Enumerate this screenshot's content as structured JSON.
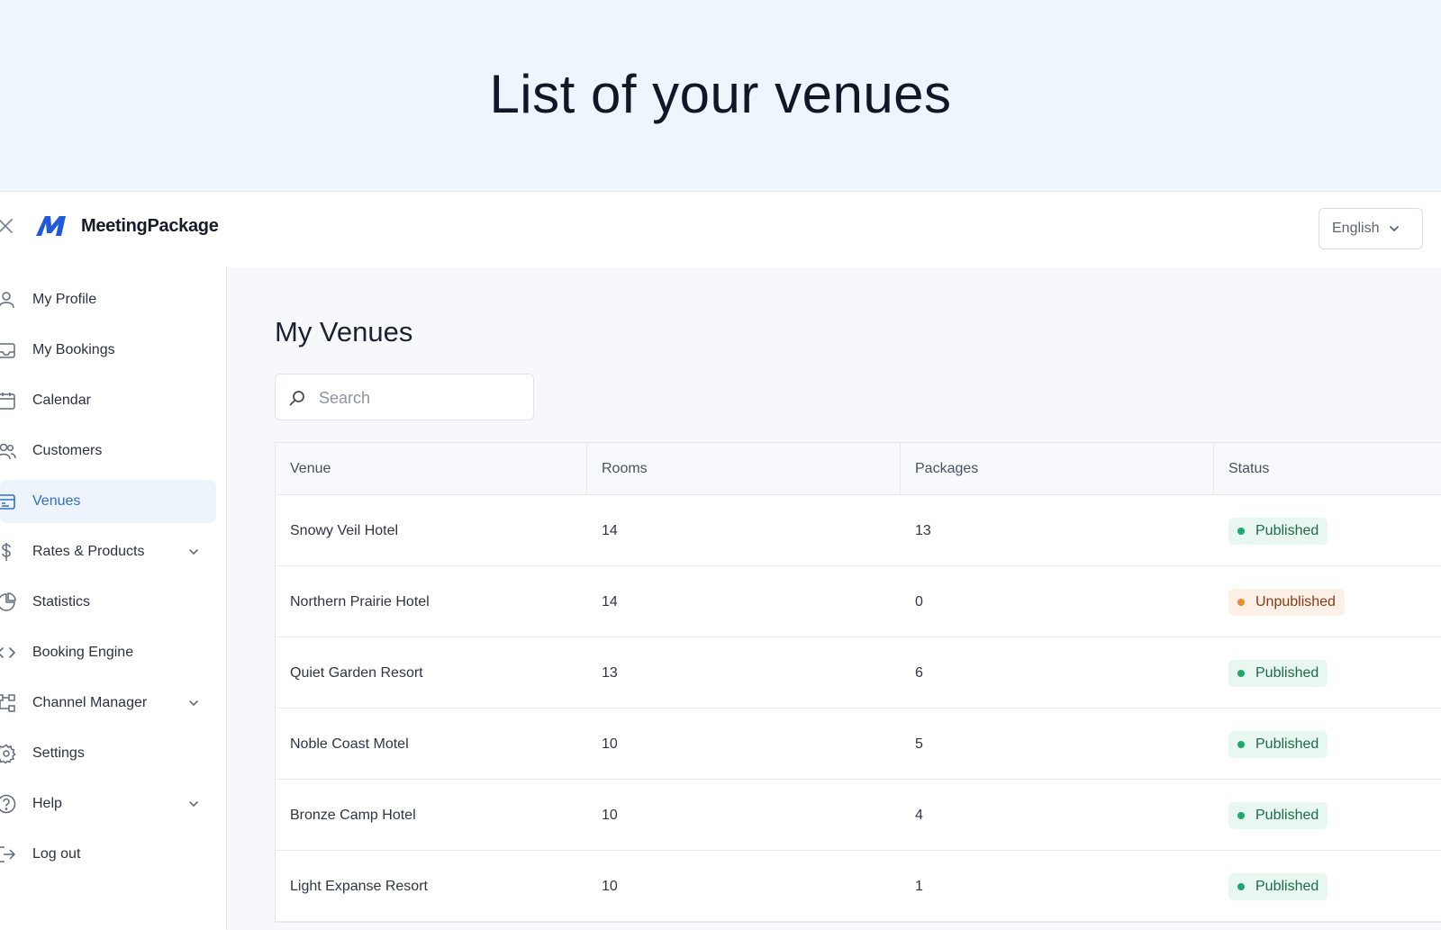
{
  "hero": {
    "title": "List of your venues"
  },
  "header": {
    "brand": "MeetingPackage",
    "language": "English",
    "colors": {
      "accent": "#2f6ed3",
      "logo": "#1f5bd8"
    }
  },
  "sidebar": {
    "items": [
      {
        "label": "My Profile",
        "icon": "user-icon",
        "active": false,
        "expandable": false
      },
      {
        "label": "My Bookings",
        "icon": "inbox-icon",
        "active": false,
        "expandable": false
      },
      {
        "label": "Calendar",
        "icon": "calendar-icon",
        "active": false,
        "expandable": false
      },
      {
        "label": "Customers",
        "icon": "users-icon",
        "active": false,
        "expandable": false
      },
      {
        "label": "Venues",
        "icon": "venue-icon",
        "active": true,
        "expandable": false
      },
      {
        "label": "Rates & Products",
        "icon": "dollar-icon",
        "active": false,
        "expandable": true
      },
      {
        "label": "Statistics",
        "icon": "pie-chart-icon",
        "active": false,
        "expandable": false
      },
      {
        "label": "Booking Engine",
        "icon": "code-icon",
        "active": false,
        "expandable": false
      },
      {
        "label": "Channel Manager",
        "icon": "channels-icon",
        "active": false,
        "expandable": true
      },
      {
        "label": "Settings",
        "icon": "gear-icon",
        "active": false,
        "expandable": false
      },
      {
        "label": "Help",
        "icon": "help-icon",
        "active": false,
        "expandable": true
      },
      {
        "label": "Log out",
        "icon": "logout-icon",
        "active": false,
        "expandable": false
      }
    ]
  },
  "main": {
    "title": "My Venues",
    "search": {
      "placeholder": "Search",
      "value": ""
    },
    "table": {
      "columns": [
        "Venue",
        "Rooms",
        "Packages",
        "Status"
      ],
      "rows": [
        {
          "venue": "Snowy Veil Hotel",
          "rooms": "14",
          "packages": "13",
          "status": "Published"
        },
        {
          "venue": "Northern Prairie Hotel",
          "rooms": "14",
          "packages": "0",
          "status": "Unpublished"
        },
        {
          "venue": "Quiet Garden Resort",
          "rooms": "13",
          "packages": "6",
          "status": "Published"
        },
        {
          "venue": "Noble Coast Motel",
          "rooms": "10",
          "packages": "5",
          "status": "Published"
        },
        {
          "venue": "Bronze Camp Hotel",
          "rooms": "10",
          "packages": "4",
          "status": "Published"
        },
        {
          "venue": "Light Expanse Resort",
          "rooms": "10",
          "packages": "1",
          "status": "Published"
        }
      ]
    }
  }
}
